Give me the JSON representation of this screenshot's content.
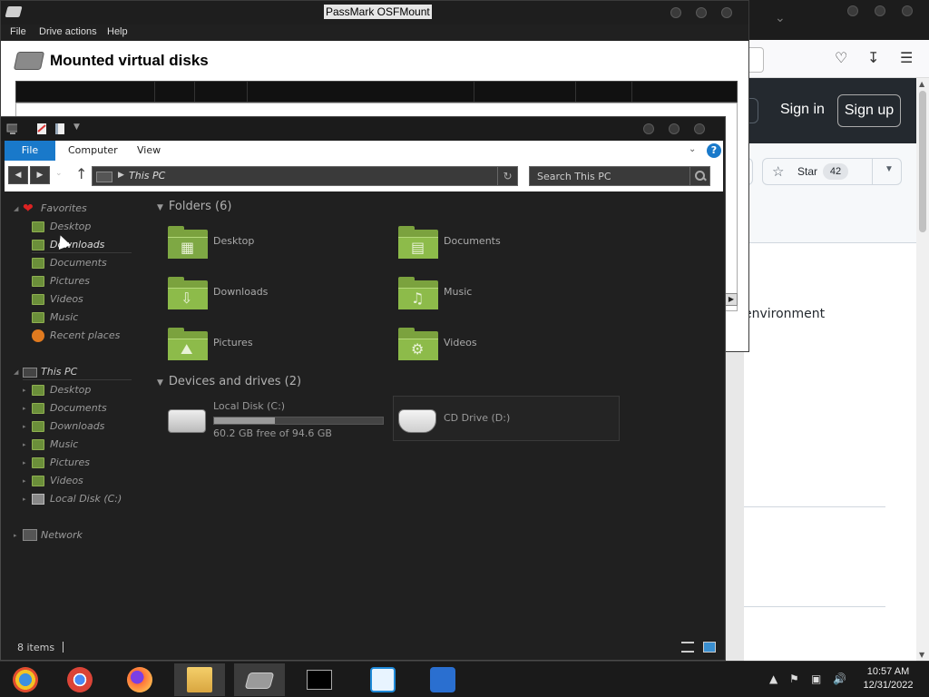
{
  "browser": {
    "sign_in": "Sign in",
    "sign_up": "Sign up",
    "star_label": "Star",
    "star_count": "42",
    "partial_text": "environment"
  },
  "osfmount": {
    "title": "PassMark OSFMount",
    "menu": [
      "File",
      "Drive actions",
      "Help"
    ],
    "heading": "Mounted virtual disks"
  },
  "explorer": {
    "ribbon_tabs": [
      "File",
      "Computer",
      "View"
    ],
    "address_path": "This PC",
    "search_placeholder": "Search This PC",
    "nav": {
      "favorites": "Favorites",
      "favorites_items": [
        "Desktop",
        "Downloads",
        "Documents",
        "Pictures",
        "Videos",
        "Music",
        "Recent places"
      ],
      "this_pc": "This PC",
      "this_pc_items": [
        "Desktop",
        "Documents",
        "Downloads",
        "Music",
        "Pictures",
        "Videos",
        "Local Disk (C:)"
      ],
      "network": "Network"
    },
    "folders_header": "Folders (6)",
    "folders": [
      "Desktop",
      "Documents",
      "Downloads",
      "Music",
      "Pictures",
      "Videos"
    ],
    "devices_header": "Devices and drives (2)",
    "drives": [
      {
        "name": "Local Disk (C:)",
        "free_text": "60.2 GB free of 94.6 GB",
        "used_fraction": 0.36
      },
      {
        "name": "CD Drive (D:)"
      }
    ],
    "status_items": "8 items"
  },
  "taskbar": {
    "time": "10:57 AM",
    "date": "12/31/2022"
  }
}
